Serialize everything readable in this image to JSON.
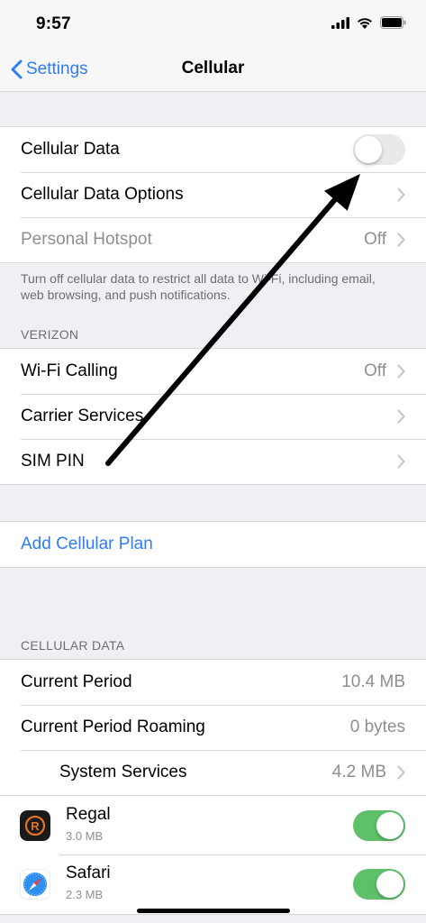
{
  "status_bar": {
    "time": "9:57"
  },
  "nav": {
    "back_label": "Settings",
    "title": "Cellular"
  },
  "group1": {
    "cellular_data": {
      "label": "Cellular Data",
      "enabled": false
    },
    "cellular_data_options": {
      "label": "Cellular Data Options"
    },
    "personal_hotspot": {
      "label": "Personal Hotspot",
      "value": "Off"
    }
  },
  "group1_footer": "Turn off cellular data to restrict all data to Wi-Fi, including email, web browsing, and push notifications.",
  "carrier_header": "VERIZON",
  "group2": {
    "wifi_calling": {
      "label": "Wi-Fi Calling",
      "value": "Off"
    },
    "carrier_services": {
      "label": "Carrier Services"
    },
    "sim_pin": {
      "label": "SIM PIN"
    }
  },
  "add_plan": {
    "label": "Add Cellular Plan"
  },
  "usage_header": "CELLULAR DATA",
  "usage": {
    "current_period": {
      "label": "Current Period",
      "value": "10.4 MB"
    },
    "current_period_roaming": {
      "label": "Current Period Roaming",
      "value": "0 bytes"
    },
    "system_services": {
      "label": "System Services",
      "value": "4.2 MB"
    }
  },
  "apps": [
    {
      "name": "Regal",
      "size": "3.0 MB",
      "enabled": true,
      "icon": "regal-app-icon"
    },
    {
      "name": "Safari",
      "size": "2.3 MB",
      "enabled": true,
      "icon": "safari-app-icon"
    }
  ],
  "colors": {
    "accent": "#2f7cf6",
    "toggle_on": "#5ec16a",
    "background": "#efeff4"
  }
}
